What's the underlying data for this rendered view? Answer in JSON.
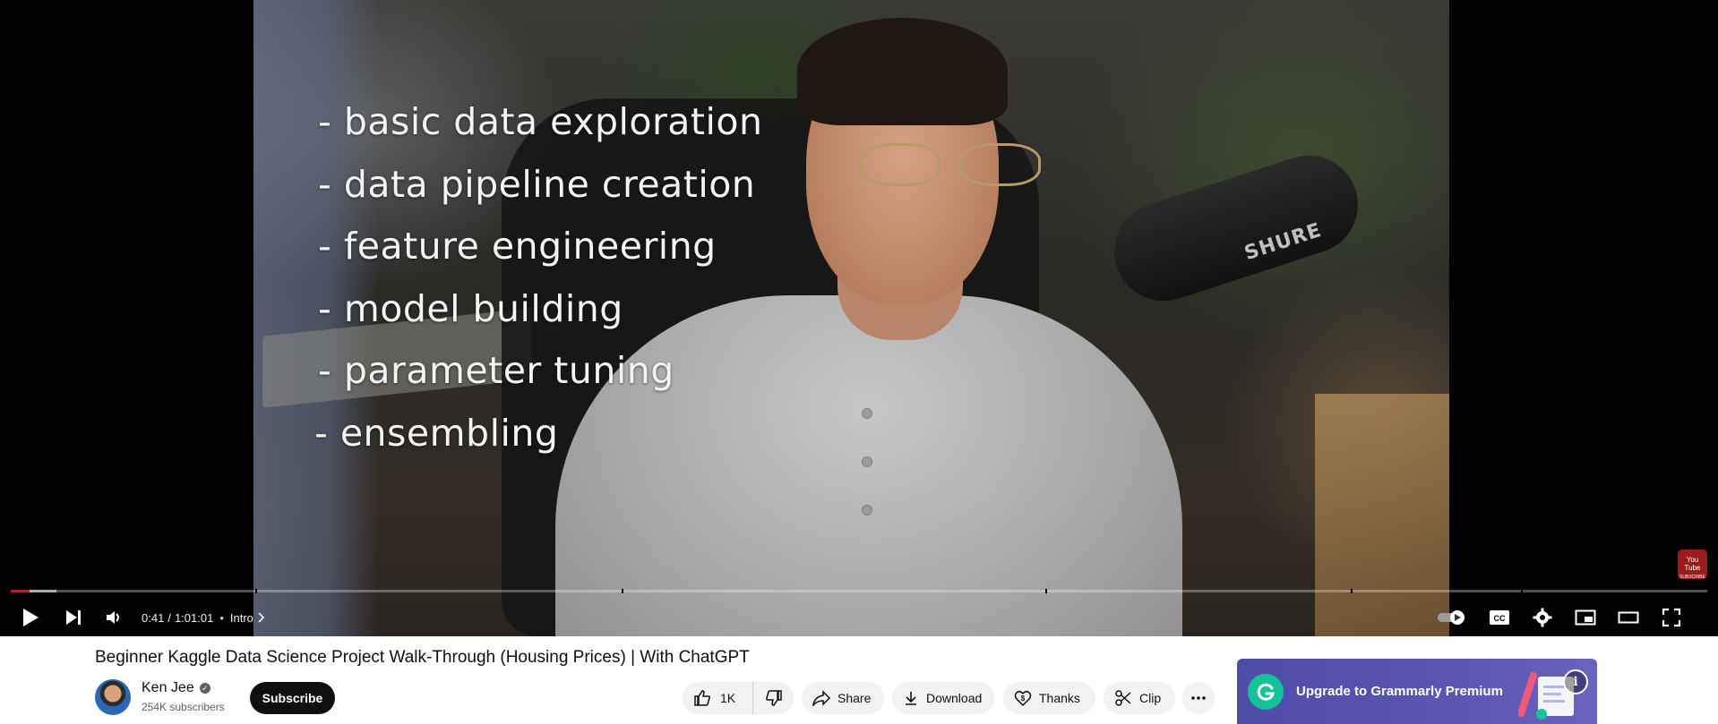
{
  "video": {
    "overlay_lines": [
      "- basic data exploration",
      "- data pipeline creation",
      "- feature engineering",
      "- model building",
      "- parameter tuning",
      "- ensembling"
    ],
    "mic_brand": "SHURE",
    "watermark_icon": "youtube-logo-icon"
  },
  "player": {
    "current_time": "0:41",
    "separator": "/",
    "duration": "1:01:01",
    "chapter_dot": "•",
    "chapter": "Intro",
    "progress_fraction": 0.011,
    "buffered_fraction": 0.027,
    "chapter_marks_fraction": [
      0.144,
      0.36,
      0.61,
      0.79,
      0.89
    ],
    "icons": {
      "play": "play-icon",
      "next": "next-icon",
      "volume": "volume-icon",
      "autoplay": "autoplay-toggle-icon",
      "captions": "captions-icon",
      "settings": "gear-icon",
      "miniplayer": "miniplayer-icon",
      "theater": "theater-mode-icon",
      "fullscreen": "fullscreen-icon"
    },
    "colors": {
      "progress": "#ff0000",
      "background": "#000000"
    }
  },
  "info": {
    "title": "Beginner Kaggle Data Science Project Walk-Through (Housing Prices) | With ChatGPT",
    "channel": {
      "name": "Ken Jee",
      "subscribers": "254K subscribers",
      "verified_icon": "verified-check-icon"
    },
    "subscribe_label": "Subscribe"
  },
  "actions": {
    "like_count": "1K",
    "share_label": "Share",
    "download_label": "Download",
    "thanks_label": "Thanks",
    "clip_label": "Clip",
    "more_icon": "more-horizontal-icon"
  },
  "ad": {
    "text": "Upgrade to Grammarly Premium",
    "info_symbol": "i",
    "colors": {
      "background": "#5a56b2",
      "logo": "#15c39a"
    }
  }
}
